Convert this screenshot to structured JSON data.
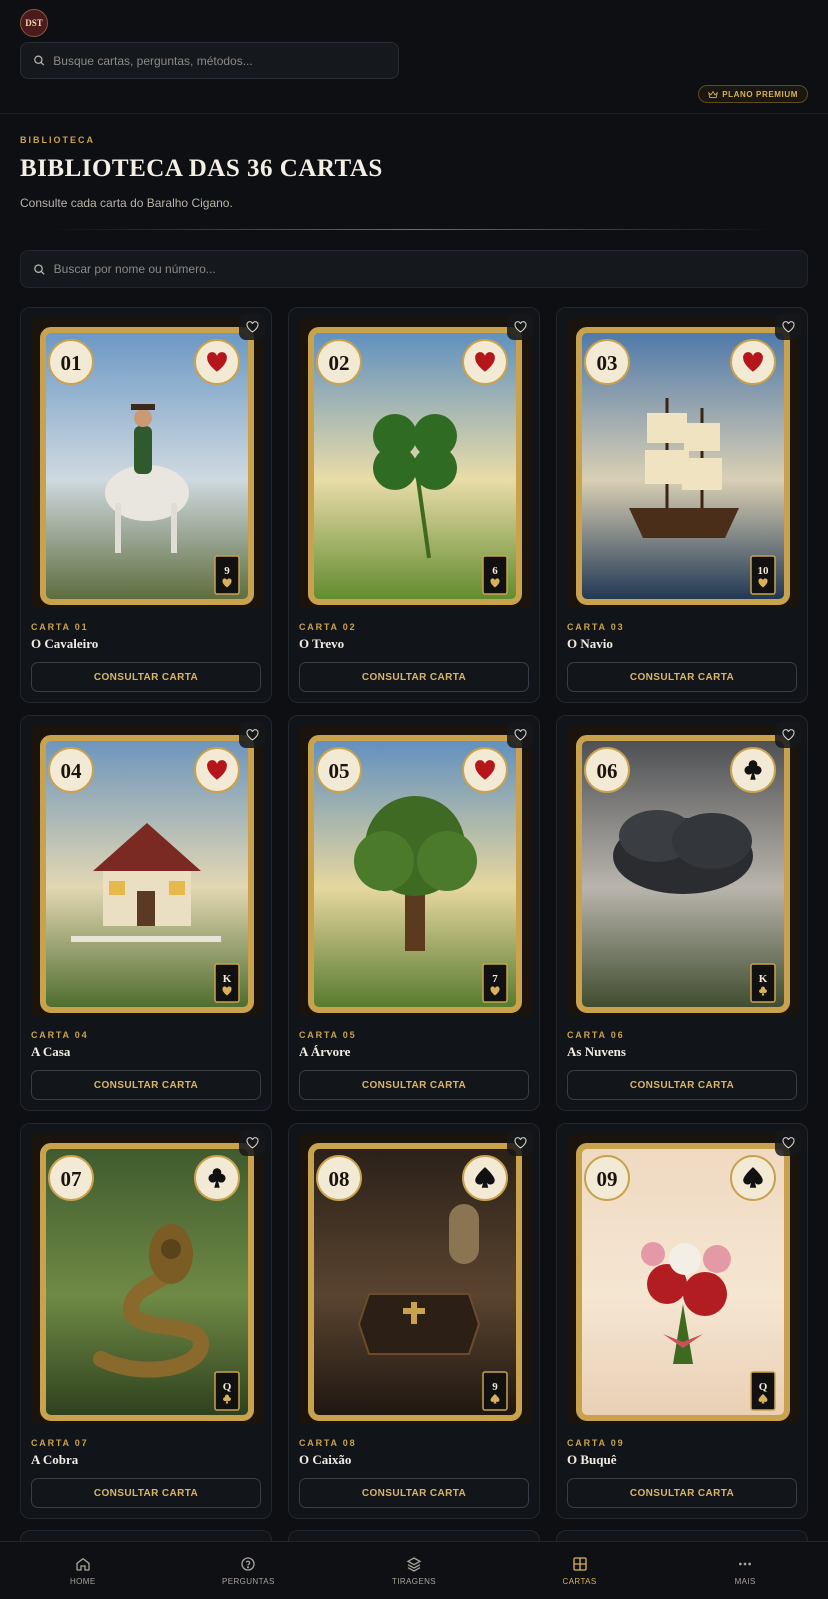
{
  "header": {
    "logo_text": "DST",
    "search_placeholder": "Busque cartas, perguntas, métodos...",
    "premium_label": "PLANO PREMIUM"
  },
  "library": {
    "eyebrow": "BIBLIOTECA",
    "title": "BIBLIOTECA DAS 36 CARTAS",
    "subtitle": "Consulte cada carta do Baralho Cigano.",
    "search_placeholder": "Buscar por nome ou número...",
    "consult_label": "CONSULTAR CARTA"
  },
  "cards": [
    {
      "number": "01",
      "label": "CARTA 01",
      "name": "O Cavaleiro",
      "suit": "heart",
      "rank": "9",
      "theme": "rider"
    },
    {
      "number": "02",
      "label": "CARTA 02",
      "name": "O Trevo",
      "suit": "heart",
      "rank": "6",
      "theme": "clover"
    },
    {
      "number": "03",
      "label": "CARTA 03",
      "name": "O Navio",
      "suit": "heart",
      "rank": "10",
      "theme": "ship"
    },
    {
      "number": "04",
      "label": "CARTA 04",
      "name": "A Casa",
      "suit": "heart",
      "rank": "K",
      "theme": "house"
    },
    {
      "number": "05",
      "label": "CARTA 05",
      "name": "A Árvore",
      "suit": "heart",
      "rank": "7",
      "theme": "tree"
    },
    {
      "number": "06",
      "label": "CARTA 06",
      "name": "As Nuvens",
      "suit": "club",
      "rank": "K",
      "theme": "clouds"
    },
    {
      "number": "07",
      "label": "CARTA 07",
      "name": "A Cobra",
      "suit": "club",
      "rank": "Q",
      "theme": "snake"
    },
    {
      "number": "08",
      "label": "CARTA 08",
      "name": "O Caixão",
      "suit": "spade",
      "rank": "9",
      "theme": "coffin"
    },
    {
      "number": "09",
      "label": "CARTA 09",
      "name": "O Buquê",
      "suit": "spade",
      "rank": "Q",
      "theme": "bouquet"
    }
  ],
  "nav": [
    {
      "label": "HOME",
      "icon": "home-icon",
      "active": false
    },
    {
      "label": "PERGUNTAS",
      "icon": "question-icon",
      "active": false
    },
    {
      "label": "TIRAGENS",
      "icon": "layers-icon",
      "active": false
    },
    {
      "label": "CARTAS",
      "icon": "grid-icon",
      "active": true
    },
    {
      "label": "MAIS",
      "icon": "more-icon",
      "active": false
    }
  ],
  "colors": {
    "accent": "#c9a24e",
    "background": "#0d0f13",
    "card_bg": "#111419",
    "suit_red": "#b5161c",
    "suit_black": "#111111"
  }
}
